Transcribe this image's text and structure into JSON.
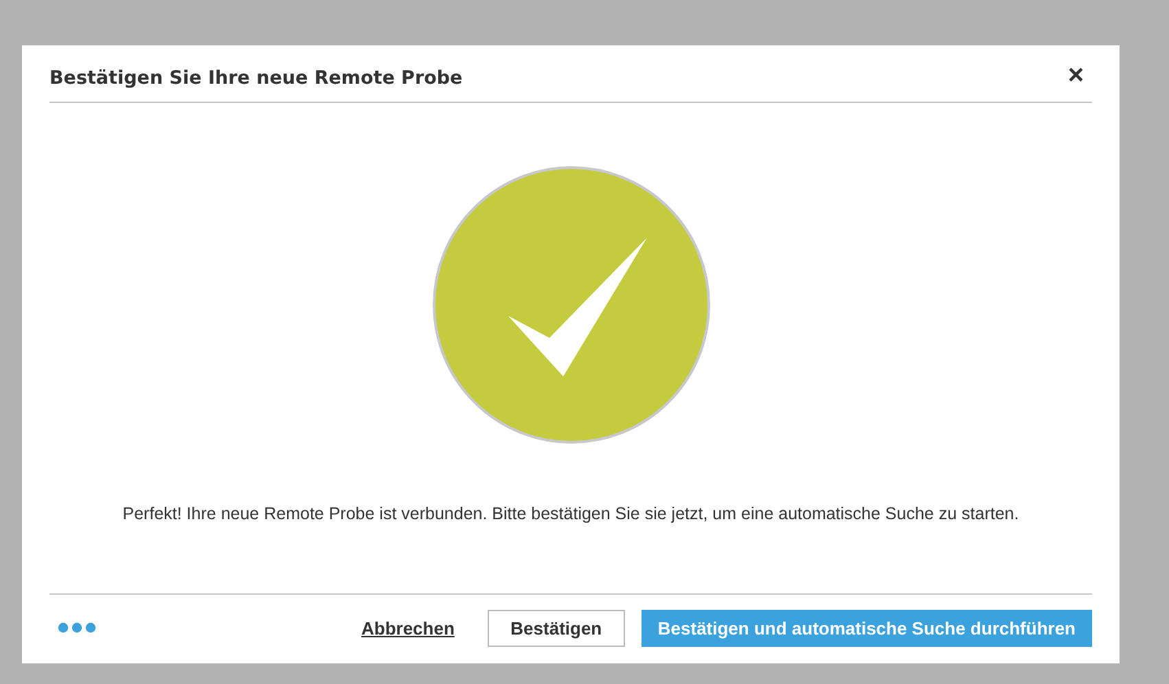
{
  "dialog": {
    "title": "Bestätigen Sie Ihre neue Remote Probe",
    "close": "×",
    "message": "Perfekt! Ihre neue Remote Probe ist verbunden. Bitte bestätigen Sie sie jetzt, um eine automatische Suche zu starten.",
    "buttons": [
      {
        "label": "Abbrechen",
        "kind": "link"
      },
      {
        "label": "Bestätigen",
        "kind": "secondary"
      },
      {
        "label": "Bestätigen und automatische Suche durchführen",
        "kind": "primary"
      }
    ]
  }
}
